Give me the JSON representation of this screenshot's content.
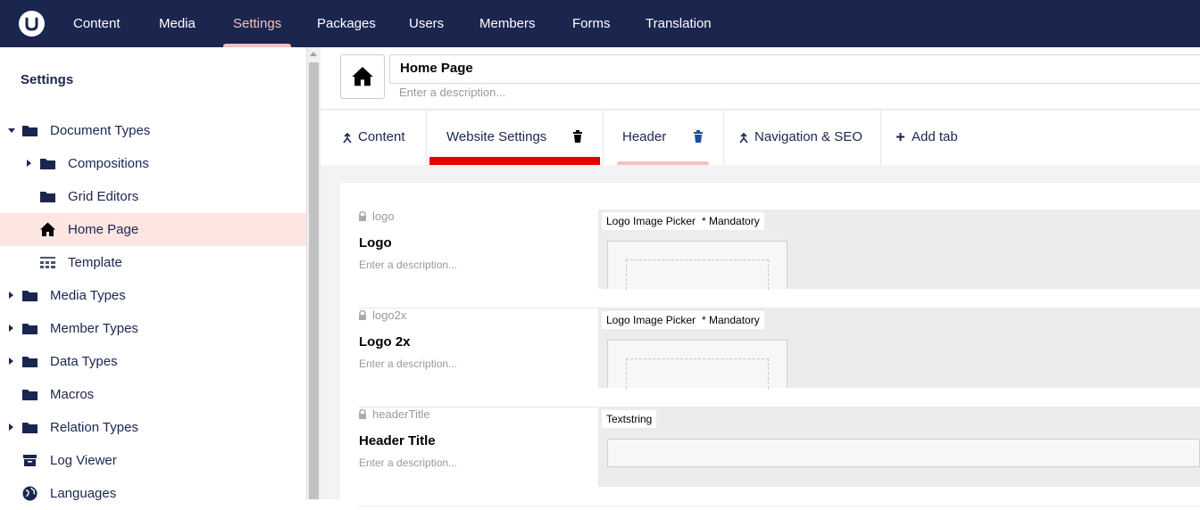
{
  "topnav": {
    "items": [
      {
        "label": "Content"
      },
      {
        "label": "Media"
      },
      {
        "label": "Settings"
      },
      {
        "label": "Packages"
      },
      {
        "label": "Users"
      },
      {
        "label": "Members"
      },
      {
        "label": "Forms"
      },
      {
        "label": "Translation"
      }
    ],
    "active": "Settings",
    "colors": {
      "bar": "#1b264f",
      "active": "#f5c1bc"
    }
  },
  "sidebar": {
    "title": "Settings",
    "items": [
      {
        "label": "Document Types",
        "icon": "folder-icon",
        "expanded": true
      },
      {
        "label": "Compositions",
        "icon": "folder-icon"
      },
      {
        "label": "Grid Editors",
        "icon": "folder-icon"
      },
      {
        "label": "Home Page",
        "icon": "home-icon",
        "selected": true
      },
      {
        "label": "Template",
        "icon": "grid-icon"
      },
      {
        "label": "Media Types",
        "icon": "folder-icon"
      },
      {
        "label": "Member Types",
        "icon": "folder-icon"
      },
      {
        "label": "Data Types",
        "icon": "folder-icon"
      },
      {
        "label": "Macros",
        "icon": "folder-icon"
      },
      {
        "label": "Relation Types",
        "icon": "folder-icon"
      },
      {
        "label": "Log Viewer",
        "icon": "box-icon"
      },
      {
        "label": "Languages",
        "icon": "globe-icon"
      }
    ]
  },
  "editor": {
    "name": "Home Page",
    "description_placeholder": "Enter a description...",
    "icon": "home-icon"
  },
  "tabs": [
    {
      "label": "Content",
      "icon": "sort-icon"
    },
    {
      "label": "Website Settings",
      "icon": "trash-icon",
      "indicator_color": "#e60000"
    },
    {
      "label": "Header",
      "icon": "trash-icon",
      "indicator_color": "#f5c1bc"
    },
    {
      "label": "Navigation & SEO",
      "icon": "sort-icon"
    },
    {
      "label": "Add tab",
      "icon": "plus-icon"
    }
  ],
  "properties": [
    {
      "alias": "logo",
      "label": "Logo",
      "description": "Enter a description...",
      "editor": "Logo Image Picker",
      "mandatory": "* Mandatory"
    },
    {
      "alias": "logo2x",
      "label": "Logo 2x",
      "description": "Enter a description...",
      "editor": "Logo Image Picker",
      "mandatory": "* Mandatory"
    },
    {
      "alias": "headerTitle",
      "label": "Header Title",
      "description": "Enter a description...",
      "editor": "Textstring"
    }
  ]
}
